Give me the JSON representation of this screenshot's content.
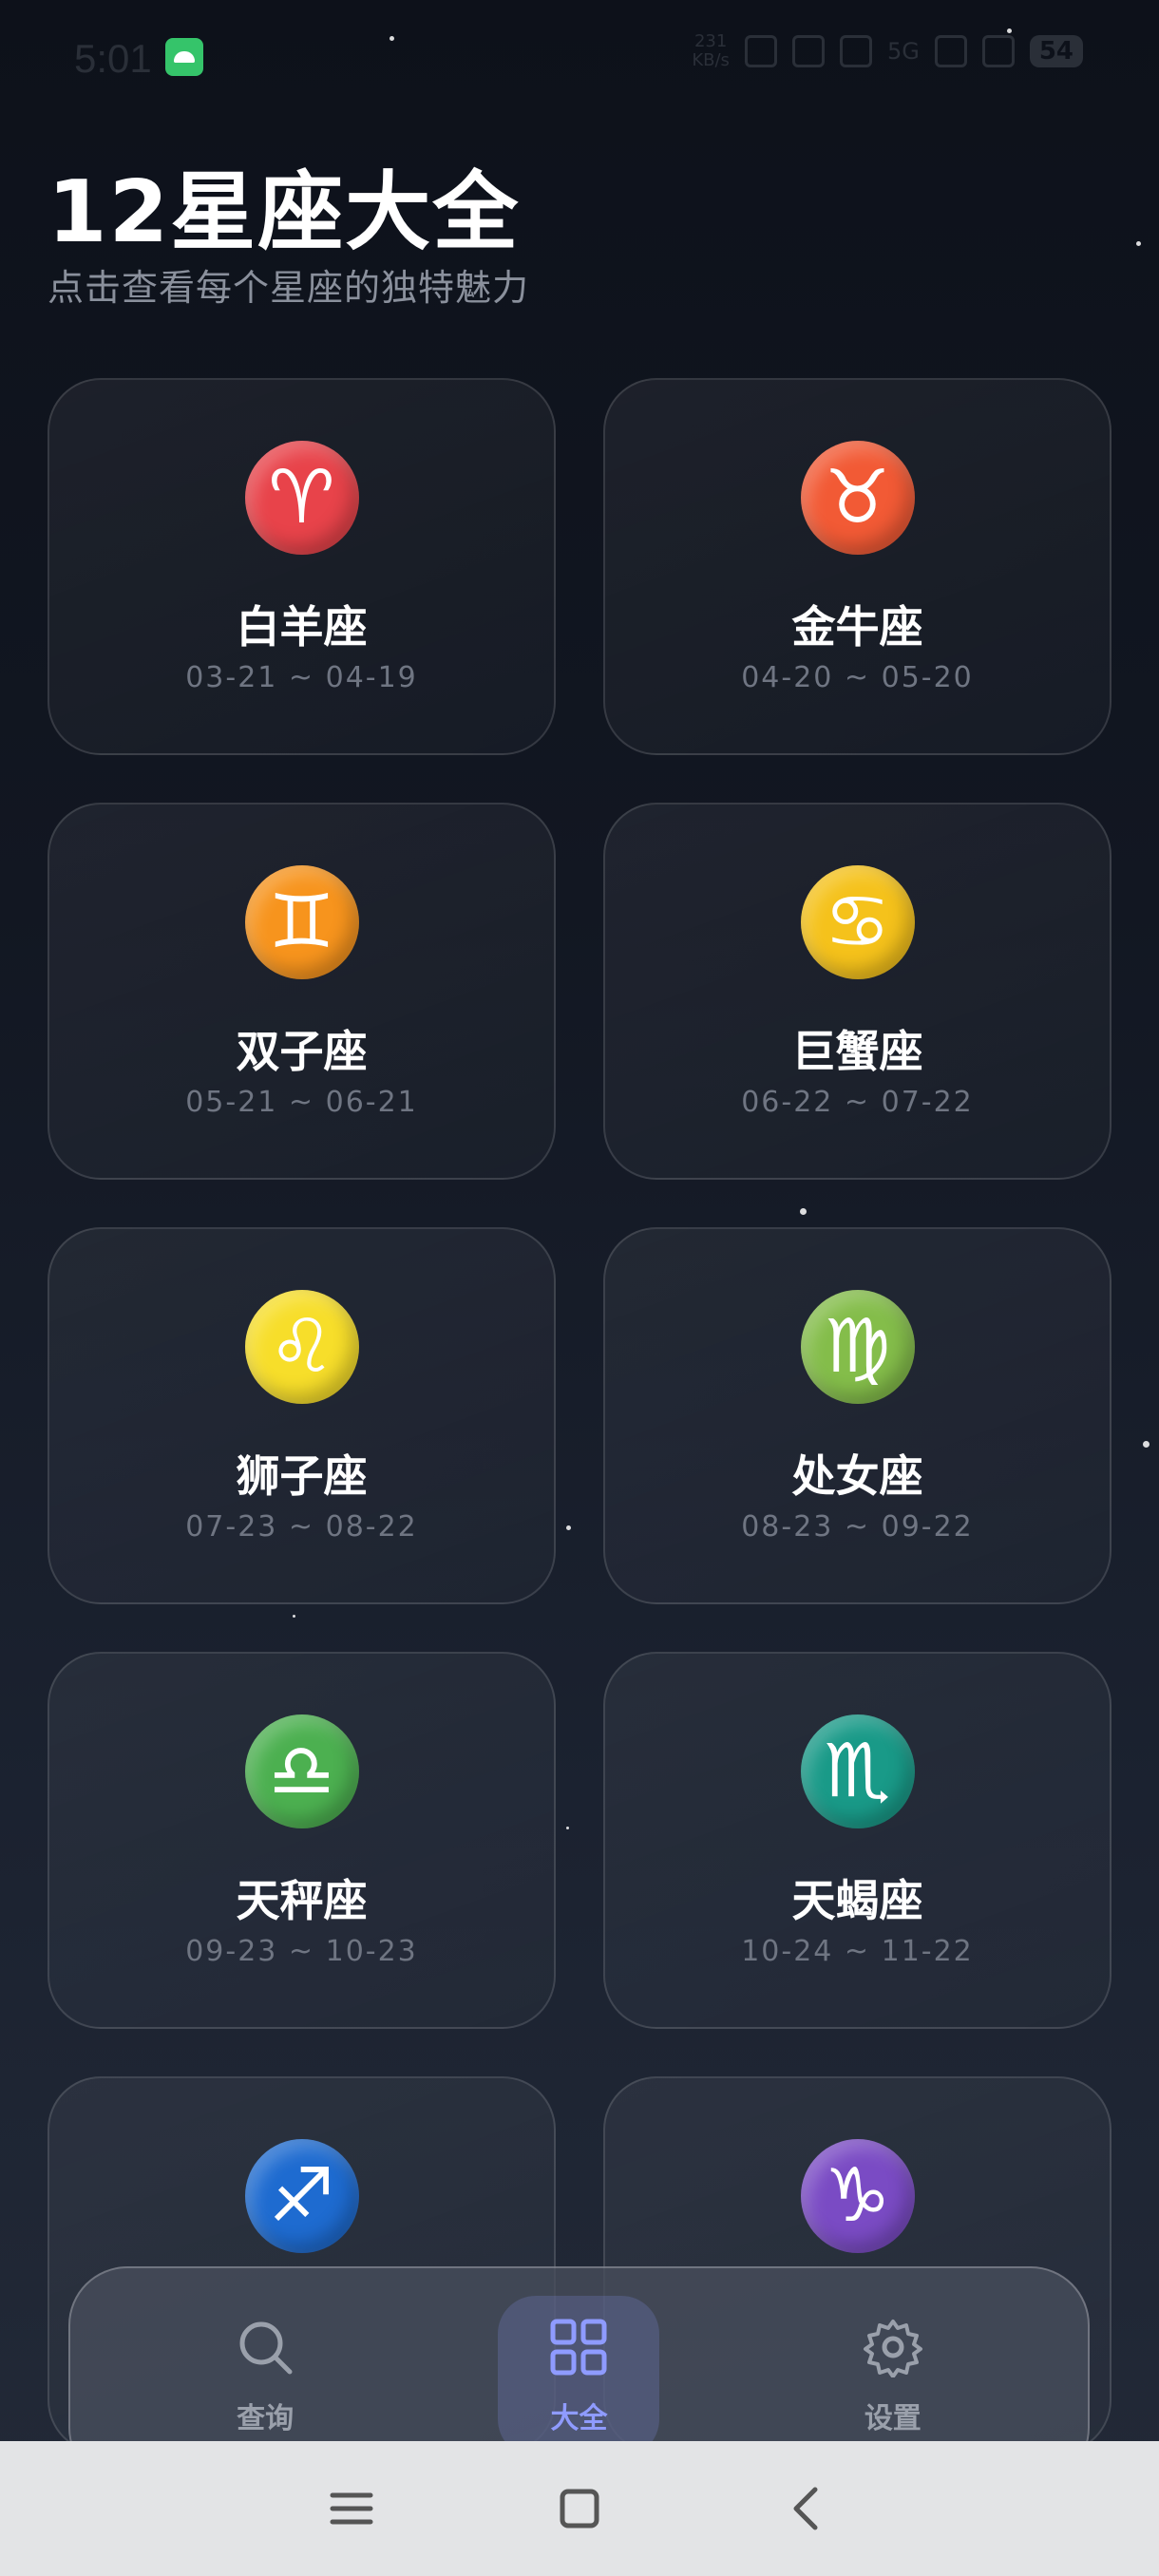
{
  "status_bar": {
    "time": "5:01",
    "network_speed": "231\nKB/s",
    "network_type": "5G",
    "battery": "54"
  },
  "header": {
    "title": "12星座大全",
    "subtitle": "点击查看每个星座的独特魅力"
  },
  "zodiac": [
    {
      "name": "白羊座",
      "dates": "03-21 ~ 04-19",
      "symbol": "♈",
      "color": "#e8434a"
    },
    {
      "name": "金牛座",
      "dates": "04-20 ~ 05-20",
      "symbol": "♉",
      "color": "#f25a35"
    },
    {
      "name": "双子座",
      "dates": "05-21 ~ 06-21",
      "symbol": "♊",
      "color": "#f7941d"
    },
    {
      "name": "巨蟹座",
      "dates": "06-22 ~ 07-22",
      "symbol": "♋",
      "color": "#f5c21b"
    },
    {
      "name": "狮子座",
      "dates": "07-23 ~ 08-22",
      "symbol": "♌",
      "color": "#f7de2a"
    },
    {
      "name": "处女座",
      "dates": "08-23 ~ 09-22",
      "symbol": "♍",
      "color": "#84bd4a"
    },
    {
      "name": "天秤座",
      "dates": "09-23 ~ 10-23",
      "symbol": "♎",
      "color": "#4cb050"
    },
    {
      "name": "天蝎座",
      "dates": "10-24 ~ 11-22",
      "symbol": "♏",
      "color": "#199a88"
    },
    {
      "name": "",
      "dates": "",
      "symbol": "♐",
      "color": "#1e6bd0"
    },
    {
      "name": "",
      "dates": "",
      "symbol": "♑",
      "color": "#7a4bc4"
    }
  ],
  "bottom_nav": [
    {
      "label": "查询",
      "icon": "search-icon",
      "active": false
    },
    {
      "label": "大全",
      "icon": "grid-icon",
      "active": true
    },
    {
      "label": "设置",
      "icon": "gear-icon",
      "active": false
    }
  ]
}
